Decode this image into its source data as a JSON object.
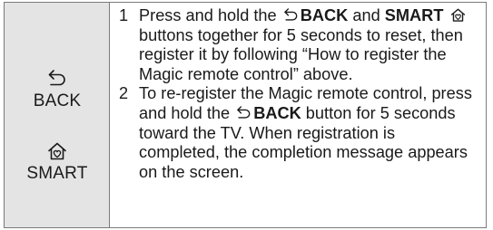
{
  "keys": {
    "back_label": "BACK",
    "back_icon": "back-arrow-icon",
    "smart_label": "SMART",
    "smart_icon": "home-icon"
  },
  "steps": [
    {
      "number": "1",
      "text_a": "Press and hold the",
      "key_back": "BACK",
      "text_b": "and",
      "key_smart": "SMART",
      "text_c": "buttons together for 5 seconds to reset, then register it by following “How to register the Magic remote control” above."
    },
    {
      "number": "2",
      "text_a": "To re-register the Magic remote control, press and hold the",
      "key_back": "BACK",
      "text_b": "button for 5 seconds toward the TV. When registration is completed, the completion message appears on the screen."
    }
  ],
  "colors": {
    "key_column_background": "#e4e4e4",
    "border": "#7a7a7a",
    "text": "#1a1a1a"
  }
}
